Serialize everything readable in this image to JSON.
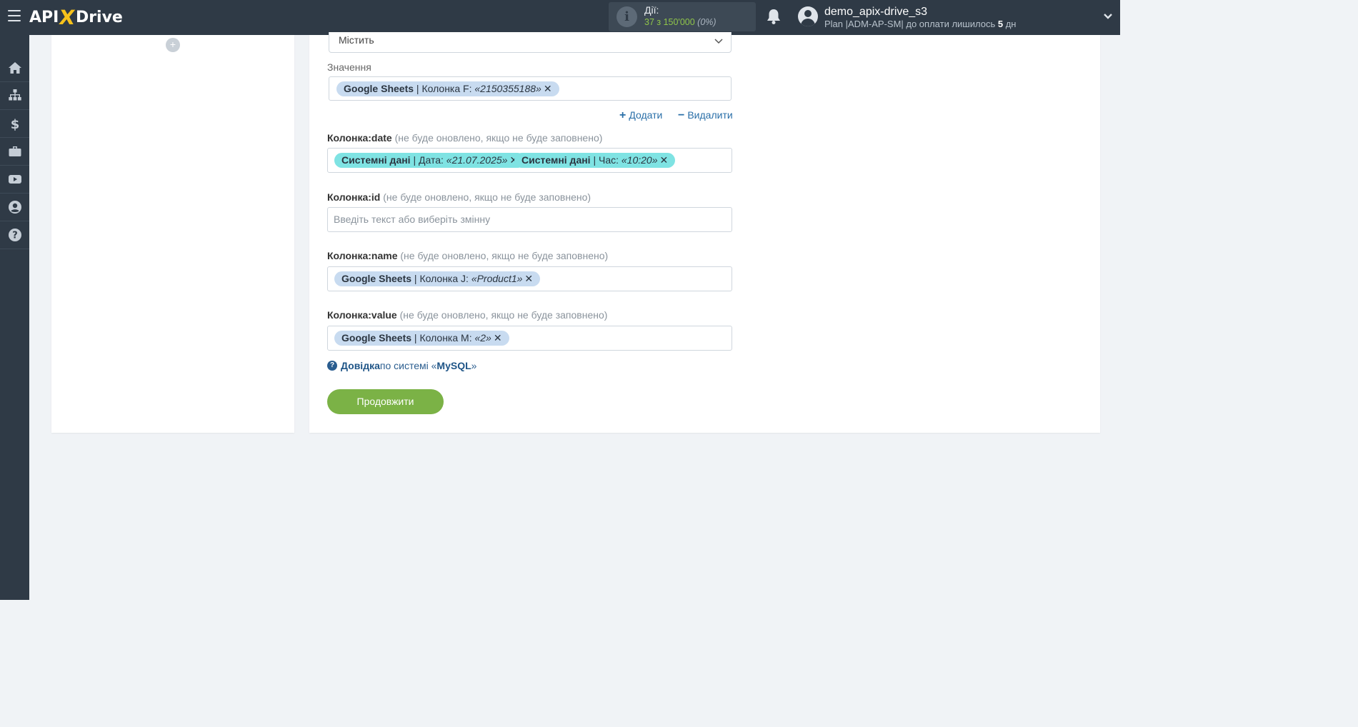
{
  "header": {
    "logo_api": "API",
    "logo_x": "X",
    "logo_drive": "Drive",
    "actions_title": "Дії:",
    "actions_count": "37 з 150'000",
    "actions_percent": "(0%)",
    "user_name": "demo_apix-drive_s3",
    "user_plan_prefix": "Plan |ADM-AP-SM| до оплати лишилось",
    "user_plan_days": "5",
    "user_plan_suffix": "дн"
  },
  "sidebar": {
    "items": [
      {
        "icon": "home-icon"
      },
      {
        "icon": "sitemap-icon"
      },
      {
        "icon": "dollar-icon"
      },
      {
        "icon": "briefcase-icon"
      },
      {
        "icon": "youtube-icon"
      },
      {
        "icon": "user-circle-icon"
      },
      {
        "icon": "question-icon"
      }
    ]
  },
  "left_panel": {
    "plus": "+"
  },
  "form": {
    "condition_select_value": "Містить",
    "value_label": "Значення",
    "value_chip": {
      "source": "Google Sheets",
      "sep": " | Колонка F: ",
      "val": "«2150355188»"
    },
    "add_label": "Додати",
    "remove_label": "Видалити",
    "fields": [
      {
        "name": "Колонка:date",
        "hint": "(не буде оновлено, якщо не буде заповнено)"
      },
      {
        "name": "Колонка:id",
        "hint": "(не буде оновлено, якщо не буде заповнено)"
      },
      {
        "name": "Колонка:name",
        "hint": "(не буде оновлено, якщо не буде заповнено)"
      },
      {
        "name": "Колонка:value",
        "hint": "(не буде оновлено, якщо не буде заповнено)"
      }
    ],
    "date_chips": [
      {
        "source": "Системні дані",
        "sep": " | Дата: ",
        "val": "«21.07.2025»"
      },
      {
        "source": "Системні дані",
        "sep": " | Час: ",
        "val": "«10:20»"
      }
    ],
    "id_placeholder": "Введіть текст або виберіть змінну",
    "name_chip": {
      "source": "Google Sheets",
      "sep": " | Колонка J: ",
      "val": "«Product1»"
    },
    "value_field_chip": {
      "source": "Google Sheets",
      "sep": " | Колонка M: ",
      "val": "«2»"
    },
    "help_link": "Довідка",
    "help_middle": " по системі «",
    "help_system": "MySQL",
    "help_end": "»",
    "continue_label": "Продовжити"
  },
  "colors": {
    "topbar": "#2f3a46",
    "accent_green": "#7bb246",
    "chip_blue": "#c8dbf0",
    "chip_teal": "#7fe3e3",
    "link_blue": "#2a6fa8"
  }
}
